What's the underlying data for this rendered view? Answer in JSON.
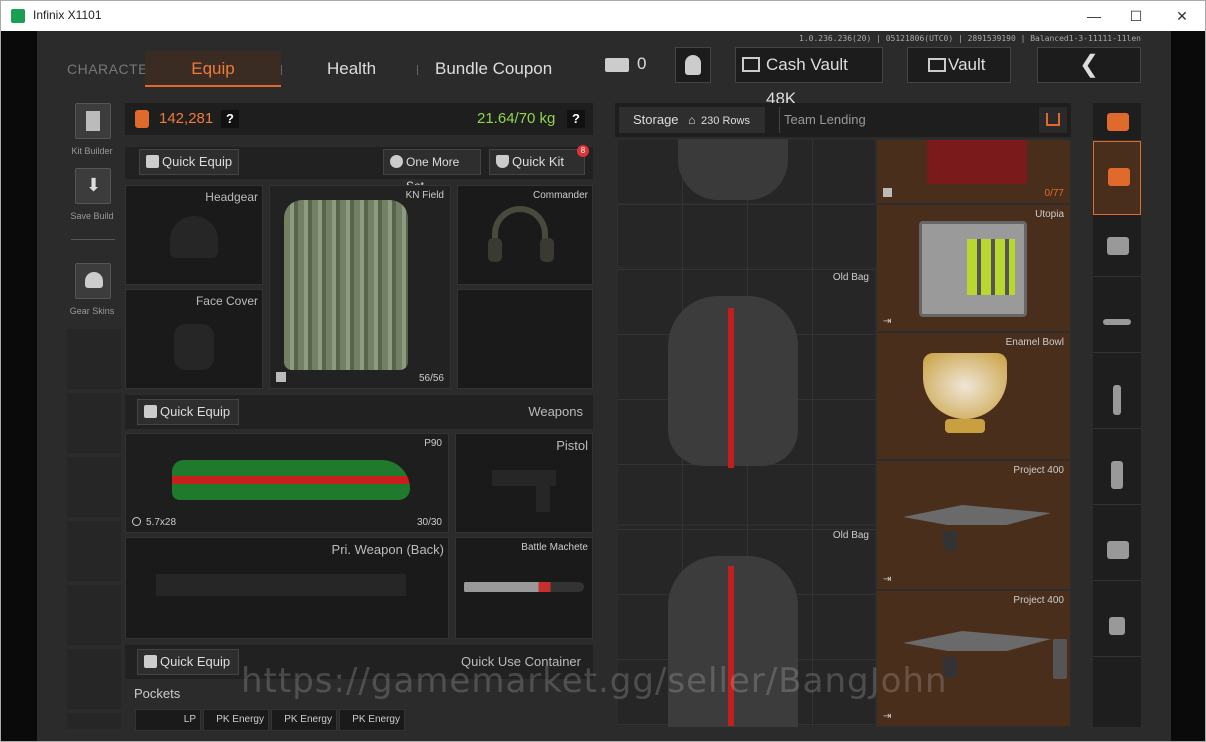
{
  "window": {
    "title": "Infinix X1101",
    "minimize": "—",
    "maximize": "☐",
    "close": "✕"
  },
  "version": "1.0.236.236(20) | 05121806(UTC0) | 2891539190 | Balanced1-3-11111-11len",
  "nav": {
    "character": "CHARACTER",
    "equip": "Equip",
    "health": "Health",
    "bundle": "Bundle Coupon"
  },
  "top": {
    "currency_count": "0",
    "cash_vault": "Cash Vault 48K",
    "vault": "Vault",
    "back": "❮"
  },
  "left_sidebar": [
    {
      "label": "Kit Builder"
    },
    {
      "label": "Save Build"
    },
    {
      "label": "Gear Skins"
    }
  ],
  "stats": {
    "value": "142,281",
    "weight": "21.64/70 kg",
    "help": "?"
  },
  "equip_buttons": {
    "quick_equip": "Quick Equip",
    "one_more_set": "One More Set",
    "quick_kit": "Quick Kit",
    "quick_kit_badge": "8"
  },
  "slots": {
    "headgear": "Headgear",
    "face_cover": "Face Cover",
    "armor": "KN Field",
    "armor_durability": "56/56",
    "headset": "Commander",
    "weapons_section": "Weapons",
    "weapons_quick_equip": "Quick Equip",
    "primary": "P90",
    "primary_ammo": "5.7x28",
    "primary_mag": "30/30",
    "pistol": "Pistol",
    "pri_back": "Pri. Weapon (Back)",
    "melee": "Battle Machete",
    "container_quick_equip": "Quick Equip",
    "quick_use": "Quick Use Container",
    "pockets": "Pockets",
    "pocket_items": [
      "LP",
      "PK Energy",
      "PK Energy",
      "PK Energy"
    ]
  },
  "storage": {
    "tab_storage": "Storage",
    "rows": "230 Rows",
    "team_lending": "Team Lending",
    "items": [
      {
        "name": "Old Bag"
      },
      {
        "name": "0/77"
      },
      {
        "name": "Utopia"
      },
      {
        "name": "Enamel Bowl"
      },
      {
        "name": "Project 400"
      },
      {
        "name": "Old Bag"
      },
      {
        "name": "Project 400"
      }
    ]
  },
  "watermark": "https://gamemarket.gg/seller/BangJohn",
  "colors": {
    "accent": "#e06a2c",
    "value": "#f07a3a",
    "weight": "#8ed64a",
    "storage_highlight": "#4a2e1c"
  }
}
